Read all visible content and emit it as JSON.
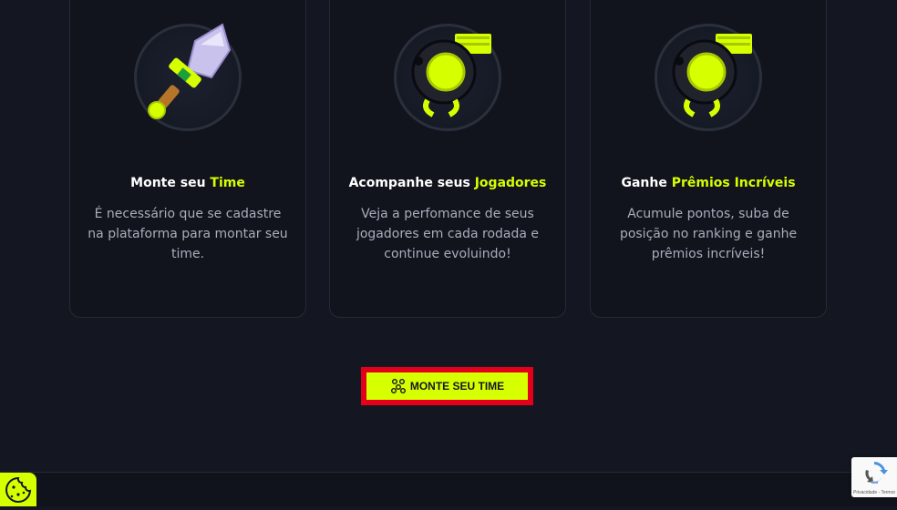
{
  "cards": [
    {
      "title_prefix": "Monte seu ",
      "title_highlight": "Time",
      "description": "É necessário que se cadastre na plataforma para montar seu time.",
      "icon": "sword-icon"
    },
    {
      "title_prefix": "Acompanhe seus ",
      "title_highlight": "Jogadores",
      "description": "Veja a perfomance de seus jogadores em cada rodada e continue evoluindo!",
      "icon": "whistle-icon"
    },
    {
      "title_prefix": "Ganhe ",
      "title_highlight": "Prêmios Incríveis",
      "description": "Acumule pontos, suba de posição no ranking e ganhe prêmios incríveis!",
      "icon": "whistle-icon"
    }
  ],
  "cta": {
    "label": "MONTE SEU TIME",
    "icon": "team-icon"
  },
  "cookie": {
    "icon": "cookie-icon"
  },
  "recaptcha": {
    "text": "Privacidade - Termos",
    "icon": "recaptcha-icon"
  },
  "colors": {
    "accent": "#d6ff00",
    "background": "#141722",
    "card": "#11141c",
    "highlight_border": "#e3001b"
  }
}
